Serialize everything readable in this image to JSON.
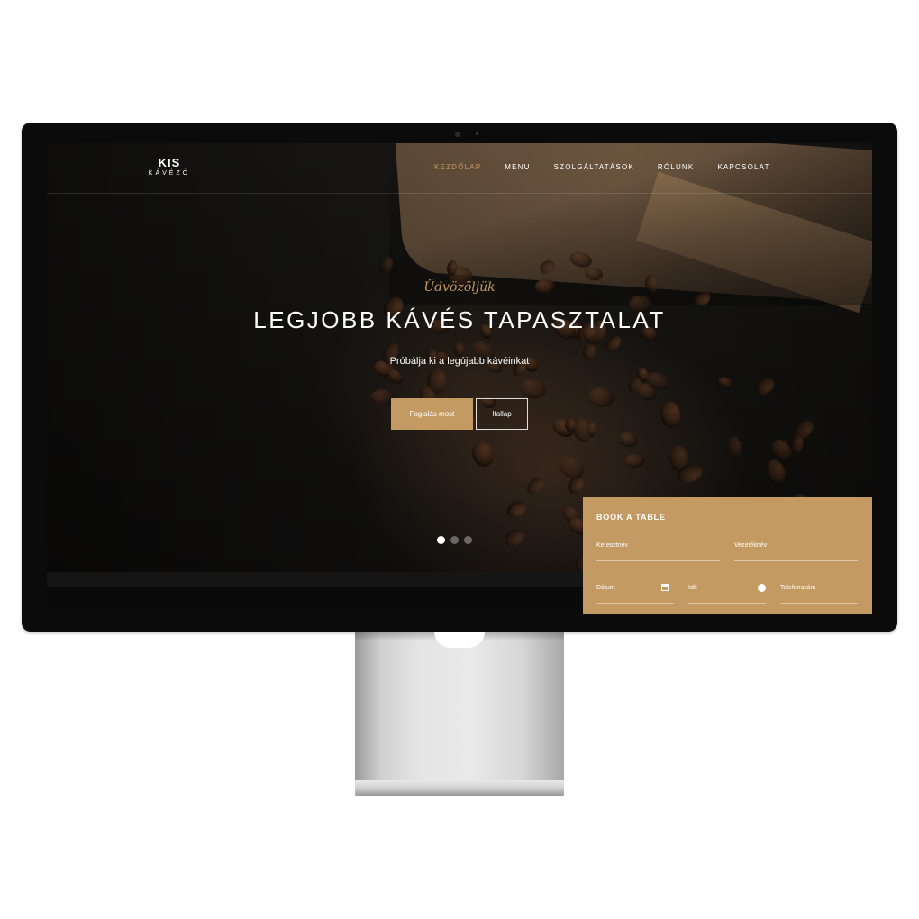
{
  "brand": {
    "name": "KIS",
    "sub": "KÁVÉZÓ"
  },
  "nav": {
    "items": [
      {
        "label": "KEZDŐLAP",
        "active": true
      },
      {
        "label": "MENU",
        "active": false
      },
      {
        "label": "SZOLGÁLTATÁSOK",
        "active": false
      },
      {
        "label": "RÓLUNK",
        "active": false
      },
      {
        "label": "KAPCSOLAT",
        "active": false
      }
    ]
  },
  "hero": {
    "welcome": "Üdvözöljük",
    "headline": "LEGJOBB KÁVÉS TAPASZTALAT",
    "subline": "Próbálja ki a legújabb kávéinkat",
    "primary_button": "Foglalás most",
    "secondary_button": "Itallap",
    "slides": 3,
    "active_slide": 1
  },
  "booking": {
    "title": "BOOK A TABLE",
    "fields": {
      "first_name": "Keresztnév",
      "last_name": "Vezetéknév",
      "date": "Dátum",
      "time": "Idő",
      "phone": "Telefonszám"
    }
  },
  "icons": {
    "date": "calendar-icon",
    "time": "clock-icon"
  },
  "colors": {
    "accent": "#c49a63",
    "text_light": "#ffffff",
    "dark_bg": "#151412",
    "monitor_bezel": "#0b0b0b"
  }
}
